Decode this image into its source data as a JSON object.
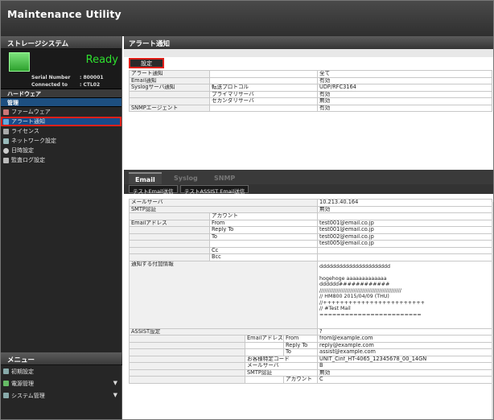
{
  "app_title": "Maintenance Utility",
  "sidebar": {
    "storage_header": "ストレージシステム",
    "status": "Ready",
    "serial_label": "Serial Number",
    "serial_value": ": 800001",
    "connected_label": "Connected to",
    "connected_value": ": CTL02",
    "hardware": "ハードウェア",
    "management": "管理",
    "items": [
      "ファームウェア",
      "アラート通知",
      "ライセンス",
      "ネットワーク設定",
      "日時設定",
      "監査ログ設定"
    ],
    "menu_header": "メニュー",
    "menu_items": [
      "初期設定",
      "電源管理",
      "システム管理"
    ]
  },
  "main": {
    "title": "アラート通知",
    "settings_button": "設定",
    "summary_rows": [
      [
        "アラート通知",
        "",
        "全て"
      ],
      [
        "Email通知",
        "",
        "有効"
      ],
      [
        "Syslogサーバ通知",
        "転送プロトコル",
        "UDP/RFC3164"
      ],
      [
        "",
        "プライマリサーバ",
        "有効"
      ],
      [
        "",
        "セカンダリサーバ",
        "無効"
      ],
      [
        "SNMPエージェント",
        "",
        "有効"
      ]
    ],
    "tabs": [
      "Email",
      "Syslog",
      "SNMP"
    ],
    "buttons": [
      "テストEmail送信",
      "テストASSIST Email送信"
    ],
    "email": {
      "mail_server_label": "メールサーバ",
      "mail_server": "10.213.40.164",
      "smtp_auth_label": "SMTP認証",
      "smtp_auth": "無効",
      "account_label": "アカウント",
      "addr_label": "Emailアドレス",
      "from_label": "From",
      "from": "test001@email.co.jp",
      "reply_label": "Reply To",
      "reply": "test001@email.co.jp",
      "to_label": "To",
      "to1": "test002@email.co.jp",
      "to2": "test005@email.co.jp",
      "cc_label": "Cc",
      "bcc_label": "Bcc",
      "extra_label": "通知する付加情報",
      "extra_lines": [
        "dddddddddddddddddddddd",
        "",
        "hogehoge aaaaaaaaaaaaa",
        "dddddd############",
        "////////////////////////////////////////////////",
        "// HM800 2015/04/09 (THU)",
        "//++++++++++++++++++++++++",
        "// #Test Mail",
        "========================"
      ],
      "assist_label": "ASSIST設定",
      "assist_value": "?",
      "assist_addr_label": "Emailアドレス",
      "assist_from": "from@example.com",
      "assist_reply": "reply@example.com",
      "assist_to": "assist@example.com",
      "customer_code_label": "お客様特定コード",
      "customer_code": "UNIT_Cinf_HT-4065_12345678_00_14GN",
      "assist_mail_server": "B",
      "assist_smtp": "無効",
      "assist_account": "C",
      "assist_account_label": "アカウント"
    }
  }
}
